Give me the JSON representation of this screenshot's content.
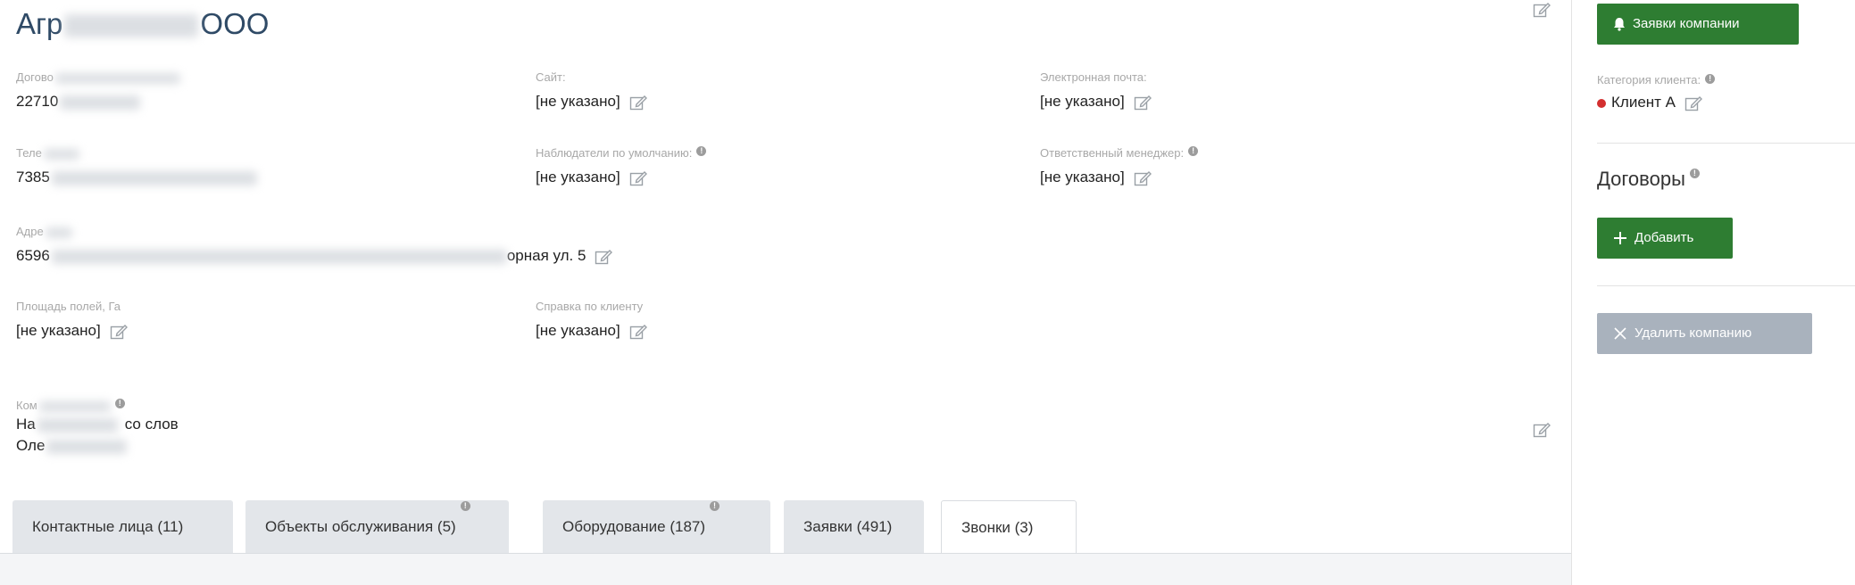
{
  "company": {
    "title_start": "Агр",
    "title_end": "ООО"
  },
  "fields": {
    "contract": {
      "label": "Догово",
      "value": "22710"
    },
    "site": {
      "label": "Сайт:",
      "value": "[не указано]"
    },
    "email": {
      "label": "Электронная почта:",
      "value": "[не указано]"
    },
    "phone": {
      "label": "Теле",
      "value": "7385"
    },
    "observers": {
      "label": "Наблюдатели по умолчанию:",
      "value": "[не указано]"
    },
    "manager": {
      "label": "Ответственный менеджер:",
      "value": "[не указано]"
    },
    "address": {
      "label": "Адре",
      "value_start": "6596",
      "value_end": "орная ул. 5"
    },
    "area": {
      "label": "Площадь полей, Га",
      "value": "[не указано]"
    },
    "reference": {
      "label": "Справка по клиенту",
      "value": "[не указано]"
    },
    "comment": {
      "label": "Ком",
      "line1_start": "На",
      "line1_end": "со слов",
      "line2": "Оле"
    }
  },
  "tabs": [
    {
      "label": "Контактные лица (11)",
      "has_info": false,
      "active": false
    },
    {
      "label": "Объекты обслуживания (5)",
      "has_info": true,
      "active": false
    },
    {
      "label": "Оборудование (187)",
      "has_info": true,
      "active": false
    },
    {
      "label": "Заявки (491)",
      "has_info": false,
      "active": false
    },
    {
      "label": "Звонки (3)",
      "has_info": false,
      "active": true
    }
  ],
  "sidebar": {
    "requests_button": "Заявки компании",
    "category_label": "Категория клиента:",
    "category_value": "Клиент А",
    "category_color": "#d32f2f",
    "contracts_title": "Договоры",
    "add_button": "Добавить",
    "delete_button": "Удалить компанию"
  },
  "colors": {
    "primary_green": "#2e7d32",
    "disabled_gray": "#a9b2bd",
    "title_blue": "#2f4a66"
  },
  "icons": {
    "edit": "edit-icon",
    "info": "info-icon",
    "bell": "bell-icon",
    "plus": "plus-icon",
    "close": "close-icon"
  }
}
